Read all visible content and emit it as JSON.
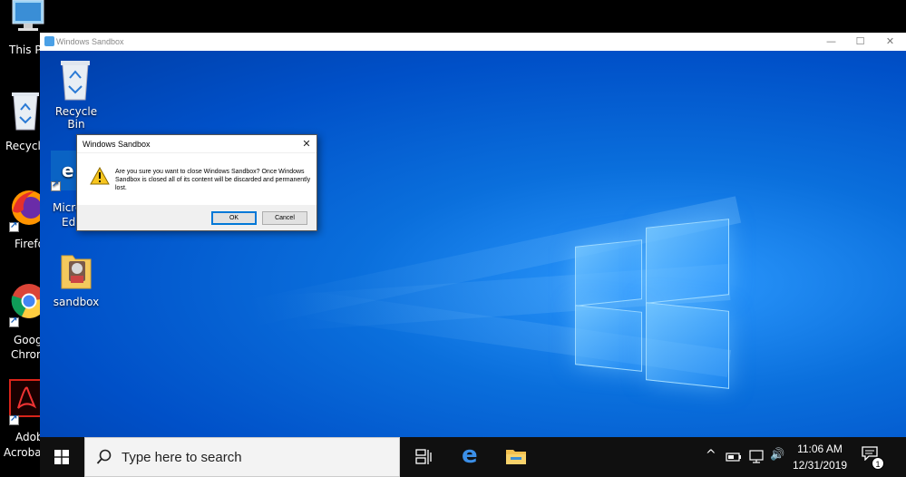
{
  "host_desktop": {
    "icons": [
      {
        "label": "This PC",
        "icon": "computer-icon"
      },
      {
        "label": "Recycle Bin",
        "icon": "recycle-bin-icon"
      },
      {
        "label": "Firefox",
        "icon": "firefox-icon"
      },
      {
        "label": "Google Chrome",
        "icon": "chrome-icon"
      },
      {
        "label": "Adobe Acrobat",
        "icon": "acrobat-icon"
      }
    ],
    "visible_fragments": {
      "this_pc": "This P",
      "recycle": "Recycle",
      "firefox": "Firefo",
      "chrome_1": "Goog",
      "chrome_2": "Chron",
      "adobe_1": "Adob",
      "adobe_2": "Acroba"
    }
  },
  "sandbox_window": {
    "title": "Windows Sandbox",
    "controls": {
      "minimize": "—",
      "maximize": "☐",
      "close": "✕"
    },
    "desktop_icons": [
      {
        "label": "Recycle Bin",
        "icon": "recycle-bin-icon"
      },
      {
        "label_line1": "Micro",
        "label_line2": "Ed",
        "icon": "edge-icon"
      },
      {
        "label": "sandbox",
        "icon": "folder-icon"
      }
    ],
    "dialog": {
      "title": "Windows Sandbox",
      "close": "✕",
      "message": "Are you sure you want to close Windows Sandbox? Once Windows Sandbox is closed all of its content will be discarded and permanently lost.",
      "ok_label": "OK",
      "cancel_label": "Cancel",
      "icon": "warning-icon"
    },
    "taskbar": {
      "search_placeholder": "Type here to search",
      "pinned": [
        "task-view-icon",
        "edge-icon",
        "file-explorer-icon"
      ],
      "tray": {
        "chevron": "^",
        "volume": "🔊"
      },
      "time": "11:06 AM",
      "date": "12/31/2019",
      "notification_count": "1"
    }
  },
  "colors": {
    "accent": "#0078d7",
    "desktop_blue": "#0a6fdc",
    "taskbar": "#101010"
  }
}
